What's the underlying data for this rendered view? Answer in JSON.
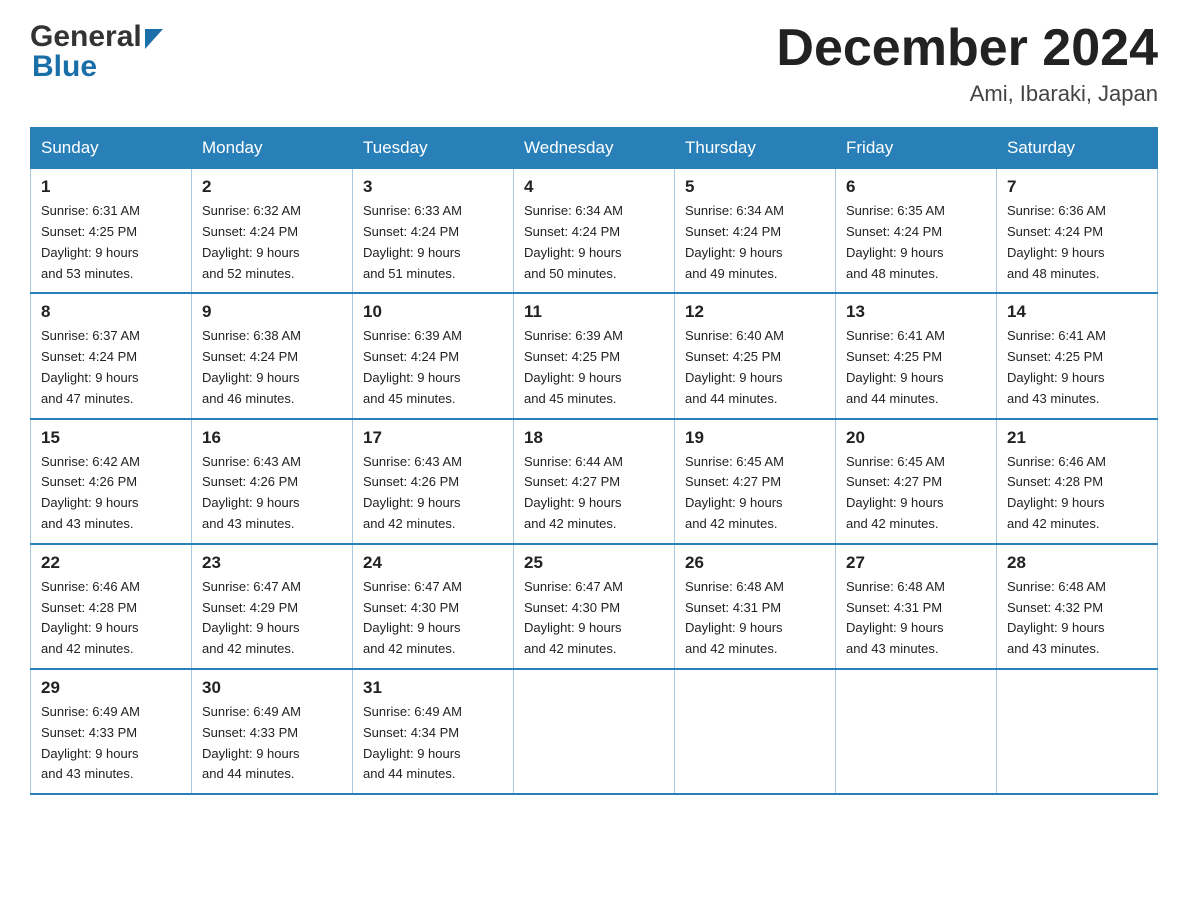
{
  "header": {
    "logo_general": "General",
    "logo_blue": "Blue",
    "month_title": "December 2024",
    "location": "Ami, Ibaraki, Japan"
  },
  "days_of_week": [
    "Sunday",
    "Monday",
    "Tuesday",
    "Wednesday",
    "Thursday",
    "Friday",
    "Saturday"
  ],
  "weeks": [
    [
      {
        "day": "1",
        "sunrise": "6:31 AM",
        "sunset": "4:25 PM",
        "daylight": "9 hours and 53 minutes."
      },
      {
        "day": "2",
        "sunrise": "6:32 AM",
        "sunset": "4:24 PM",
        "daylight": "9 hours and 52 minutes."
      },
      {
        "day": "3",
        "sunrise": "6:33 AM",
        "sunset": "4:24 PM",
        "daylight": "9 hours and 51 minutes."
      },
      {
        "day": "4",
        "sunrise": "6:34 AM",
        "sunset": "4:24 PM",
        "daylight": "9 hours and 50 minutes."
      },
      {
        "day": "5",
        "sunrise": "6:34 AM",
        "sunset": "4:24 PM",
        "daylight": "9 hours and 49 minutes."
      },
      {
        "day": "6",
        "sunrise": "6:35 AM",
        "sunset": "4:24 PM",
        "daylight": "9 hours and 48 minutes."
      },
      {
        "day": "7",
        "sunrise": "6:36 AM",
        "sunset": "4:24 PM",
        "daylight": "9 hours and 48 minutes."
      }
    ],
    [
      {
        "day": "8",
        "sunrise": "6:37 AM",
        "sunset": "4:24 PM",
        "daylight": "9 hours and 47 minutes."
      },
      {
        "day": "9",
        "sunrise": "6:38 AM",
        "sunset": "4:24 PM",
        "daylight": "9 hours and 46 minutes."
      },
      {
        "day": "10",
        "sunrise": "6:39 AM",
        "sunset": "4:24 PM",
        "daylight": "9 hours and 45 minutes."
      },
      {
        "day": "11",
        "sunrise": "6:39 AM",
        "sunset": "4:25 PM",
        "daylight": "9 hours and 45 minutes."
      },
      {
        "day": "12",
        "sunrise": "6:40 AM",
        "sunset": "4:25 PM",
        "daylight": "9 hours and 44 minutes."
      },
      {
        "day": "13",
        "sunrise": "6:41 AM",
        "sunset": "4:25 PM",
        "daylight": "9 hours and 44 minutes."
      },
      {
        "day": "14",
        "sunrise": "6:41 AM",
        "sunset": "4:25 PM",
        "daylight": "9 hours and 43 minutes."
      }
    ],
    [
      {
        "day": "15",
        "sunrise": "6:42 AM",
        "sunset": "4:26 PM",
        "daylight": "9 hours and 43 minutes."
      },
      {
        "day": "16",
        "sunrise": "6:43 AM",
        "sunset": "4:26 PM",
        "daylight": "9 hours and 43 minutes."
      },
      {
        "day": "17",
        "sunrise": "6:43 AM",
        "sunset": "4:26 PM",
        "daylight": "9 hours and 42 minutes."
      },
      {
        "day": "18",
        "sunrise": "6:44 AM",
        "sunset": "4:27 PM",
        "daylight": "9 hours and 42 minutes."
      },
      {
        "day": "19",
        "sunrise": "6:45 AM",
        "sunset": "4:27 PM",
        "daylight": "9 hours and 42 minutes."
      },
      {
        "day": "20",
        "sunrise": "6:45 AM",
        "sunset": "4:27 PM",
        "daylight": "9 hours and 42 minutes."
      },
      {
        "day": "21",
        "sunrise": "6:46 AM",
        "sunset": "4:28 PM",
        "daylight": "9 hours and 42 minutes."
      }
    ],
    [
      {
        "day": "22",
        "sunrise": "6:46 AM",
        "sunset": "4:28 PM",
        "daylight": "9 hours and 42 minutes."
      },
      {
        "day": "23",
        "sunrise": "6:47 AM",
        "sunset": "4:29 PM",
        "daylight": "9 hours and 42 minutes."
      },
      {
        "day": "24",
        "sunrise": "6:47 AM",
        "sunset": "4:30 PM",
        "daylight": "9 hours and 42 minutes."
      },
      {
        "day": "25",
        "sunrise": "6:47 AM",
        "sunset": "4:30 PM",
        "daylight": "9 hours and 42 minutes."
      },
      {
        "day": "26",
        "sunrise": "6:48 AM",
        "sunset": "4:31 PM",
        "daylight": "9 hours and 42 minutes."
      },
      {
        "day": "27",
        "sunrise": "6:48 AM",
        "sunset": "4:31 PM",
        "daylight": "9 hours and 43 minutes."
      },
      {
        "day": "28",
        "sunrise": "6:48 AM",
        "sunset": "4:32 PM",
        "daylight": "9 hours and 43 minutes."
      }
    ],
    [
      {
        "day": "29",
        "sunrise": "6:49 AM",
        "sunset": "4:33 PM",
        "daylight": "9 hours and 43 minutes."
      },
      {
        "day": "30",
        "sunrise": "6:49 AM",
        "sunset": "4:33 PM",
        "daylight": "9 hours and 44 minutes."
      },
      {
        "day": "31",
        "sunrise": "6:49 AM",
        "sunset": "4:34 PM",
        "daylight": "9 hours and 44 minutes."
      },
      null,
      null,
      null,
      null
    ]
  ],
  "labels": {
    "sunrise_prefix": "Sunrise: ",
    "sunset_prefix": "Sunset: ",
    "daylight_prefix": "Daylight: "
  }
}
